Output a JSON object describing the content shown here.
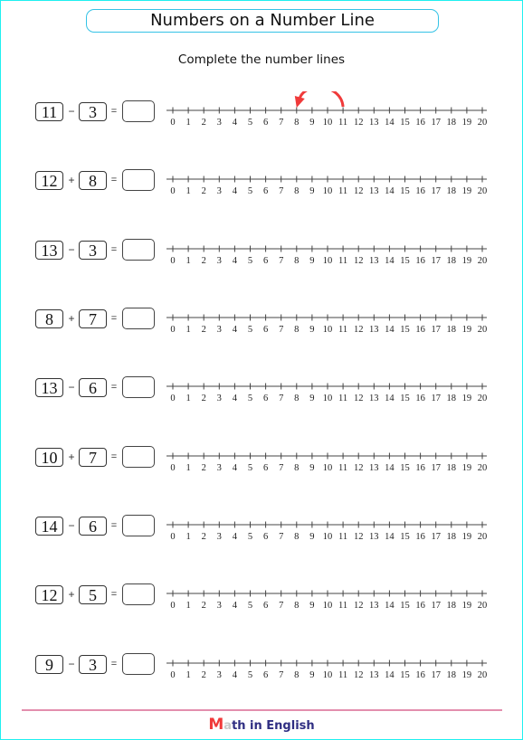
{
  "title": "Numbers on a Number Line",
  "subtitle": "Complete the number lines",
  "number_line": {
    "min": 0,
    "max": 20,
    "labels": [
      "0",
      "1",
      "2",
      "3",
      "4",
      "5",
      "6",
      "7",
      "8",
      "9",
      "10",
      "11",
      "12",
      "13",
      "14",
      "15",
      "16",
      "17",
      "18",
      "19",
      "20"
    ]
  },
  "problems": [
    {
      "a": "11",
      "op": "−",
      "b": "3",
      "eq": "=",
      "answer": "",
      "example_jump": {
        "from": 11,
        "to": 8,
        "color": "#f03a3a"
      }
    },
    {
      "a": "12",
      "op": "+",
      "b": "8",
      "eq": "=",
      "answer": ""
    },
    {
      "a": "13",
      "op": "−",
      "b": "3",
      "eq": "=",
      "answer": ""
    },
    {
      "a": "8",
      "op": "+",
      "b": "7",
      "eq": "=",
      "answer": ""
    },
    {
      "a": "13",
      "op": "−",
      "b": "6",
      "eq": "=",
      "answer": ""
    },
    {
      "a": "10",
      "op": "+",
      "b": "7",
      "eq": "=",
      "answer": ""
    },
    {
      "a": "14",
      "op": "−",
      "b": "6",
      "eq": "=",
      "answer": ""
    },
    {
      "a": "12",
      "op": "+",
      "b": "5",
      "eq": "=",
      "answer": ""
    },
    {
      "a": "9",
      "op": "−",
      "b": "3",
      "eq": "=",
      "answer": ""
    }
  ],
  "footer": {
    "logo_m": "M",
    "logo_a": "a",
    "logo_rest": "th in English"
  }
}
